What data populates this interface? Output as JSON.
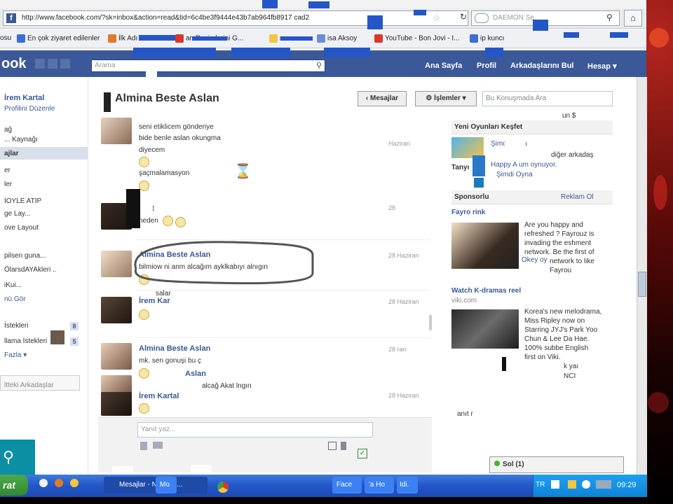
{
  "browser": {
    "url": "http://www.facebook.com/?sk=inbox&action=read&tid=6c4be3f9444e43b7ab964fb8917 cad2",
    "search_placeholder": "DAEMON Se",
    "star_glyph": "☆",
    "reload_glyph": "↻",
    "home_glyph": "⌂",
    "bookmarks": [
      {
        "label": "osu",
        "color": "#f5c542"
      },
      {
        "label": "En çok ziyaret edilenler",
        "color": "#3b6fd6"
      },
      {
        "label": "İlk Adı",
        "color": "#e07b28"
      },
      {
        "label": "an Resimlerini G...",
        "color": "#d9382c"
      },
      {
        "label": "r",
        "color": "#f5c542"
      },
      {
        "label": "isa Aksoy",
        "color": "#6b8fd6"
      },
      {
        "label": "YouTube - Bon Jovi - I...",
        "color": "#d9382c"
      },
      {
        "label": "ip kuncı",
        "color": "#3b6fd6"
      }
    ]
  },
  "fb_header": {
    "logo": "ook",
    "search_placeholder": "Arama",
    "nav": [
      "Ana Sayfa",
      "Profil",
      "Arkadaşlarını Bul",
      "Hesap ▾"
    ]
  },
  "left_nav": {
    "user_name": "İrem Kartal",
    "edit_profile": "Profilini Düzenle",
    "items": [
      "ağ",
      "... Kaynağı",
      "ajlar",
      "er",
      "ler",
      "İOYLE     ATIP",
      "ge Lay...",
      "ove Layout",
      "pilsen guna...",
      "ÖlarsdAYAkleri ..",
      "iKui...",
      "nü Gör",
      "İstekleri",
      "llama İstekleri",
      "Fazla ▾",
      "ltteki Arkadaşlar"
    ],
    "badges": [
      "8",
      "5"
    ]
  },
  "conversation": {
    "title": "Almina Beste Aslan",
    "back_button": "‹ Mesajlar",
    "actions_button": "⚙ İşlemler ▾",
    "search_placeholder": "Bu Konuşmada Ara",
    "reply_placeholder": "Yanıt yaz...",
    "hourglass": "⌛",
    "messages": [
      {
        "name": "",
        "lines": [
          "seni etiklicem gönderiye",
          "bide benle aslan okungma",
          "diyecem"
        ],
        "date": "Haziran"
      },
      {
        "name": "",
        "lines": [
          "şaçmalamasyon"
        ],
        "date": ""
      },
      {
        "name": "Kart",
        "lines": [
          "neden"
        ],
        "date": "28"
      },
      {
        "name": "Almina Beste Aslan",
        "lines": [
          "bilmiow ni       anm alcağım ayklkabıyı alnıgın"
        ],
        "date": "28 Haziran"
      },
      {
        "name": "İrem Kar",
        "lines": [
          "salar"
        ],
        "date": "28 Haziran"
      },
      {
        "name": "Almina Beste Aslan",
        "lines": [
          "mk. sen gonuşi         bu ç"
        ],
        "date": "28      ran"
      },
      {
        "name": "Aslan",
        "lines": [
          "alcağ     Akat     lngın"
        ],
        "date": ""
      },
      {
        "name": "İrem Kartal",
        "lines": [],
        "date": "28 Haziran"
      }
    ]
  },
  "right_col": {
    "games_header": "Yeni Oyunları Keşfet",
    "games_line1": "Şimdi Oyna",
    "games_line2": "diğer arkadaş",
    "games_line3": "Happy A     um oynuyor.",
    "games_line4": "Şimdi Oyna",
    "tanyi": "Tanyı",
    "sponsored": "Sponsorlu",
    "ad_create": "Reklam Ol",
    "ad1_title": "Fayro      rink",
    "ad1_text": [
      "Are you happy and",
      "refreshed ? Fayrouz is",
      "invading the     eshment",
      "network. Be the first of",
      "network to like",
      "Fayrou"
    ],
    "ad1_like": "Okey oy",
    "ad2_title": "Watch K-dramas      reel",
    "ad2_site": "viki.com",
    "ad2_text": [
      "Korea's new melodrama,",
      "Miss Ripley now on",
      "Starring JYJ's Park Yoo",
      "Chun & Lee Da Hae.",
      "100% subbe        English",
      "first on Viki."
    ],
    "misc1": "k yaı",
    "misc2": "NCI",
    "misc3": "anıt r",
    "misc4": "un $",
    "chat": "Sol       (1)"
  },
  "taskbar": {
    "start": "rat",
    "tasks": [
      "Mesajlar - N     a Fire...",
      "Mo",
      "Face",
      "'a Ho",
      "Idi."
    ],
    "lang": "TR",
    "clock": "09:29"
  }
}
